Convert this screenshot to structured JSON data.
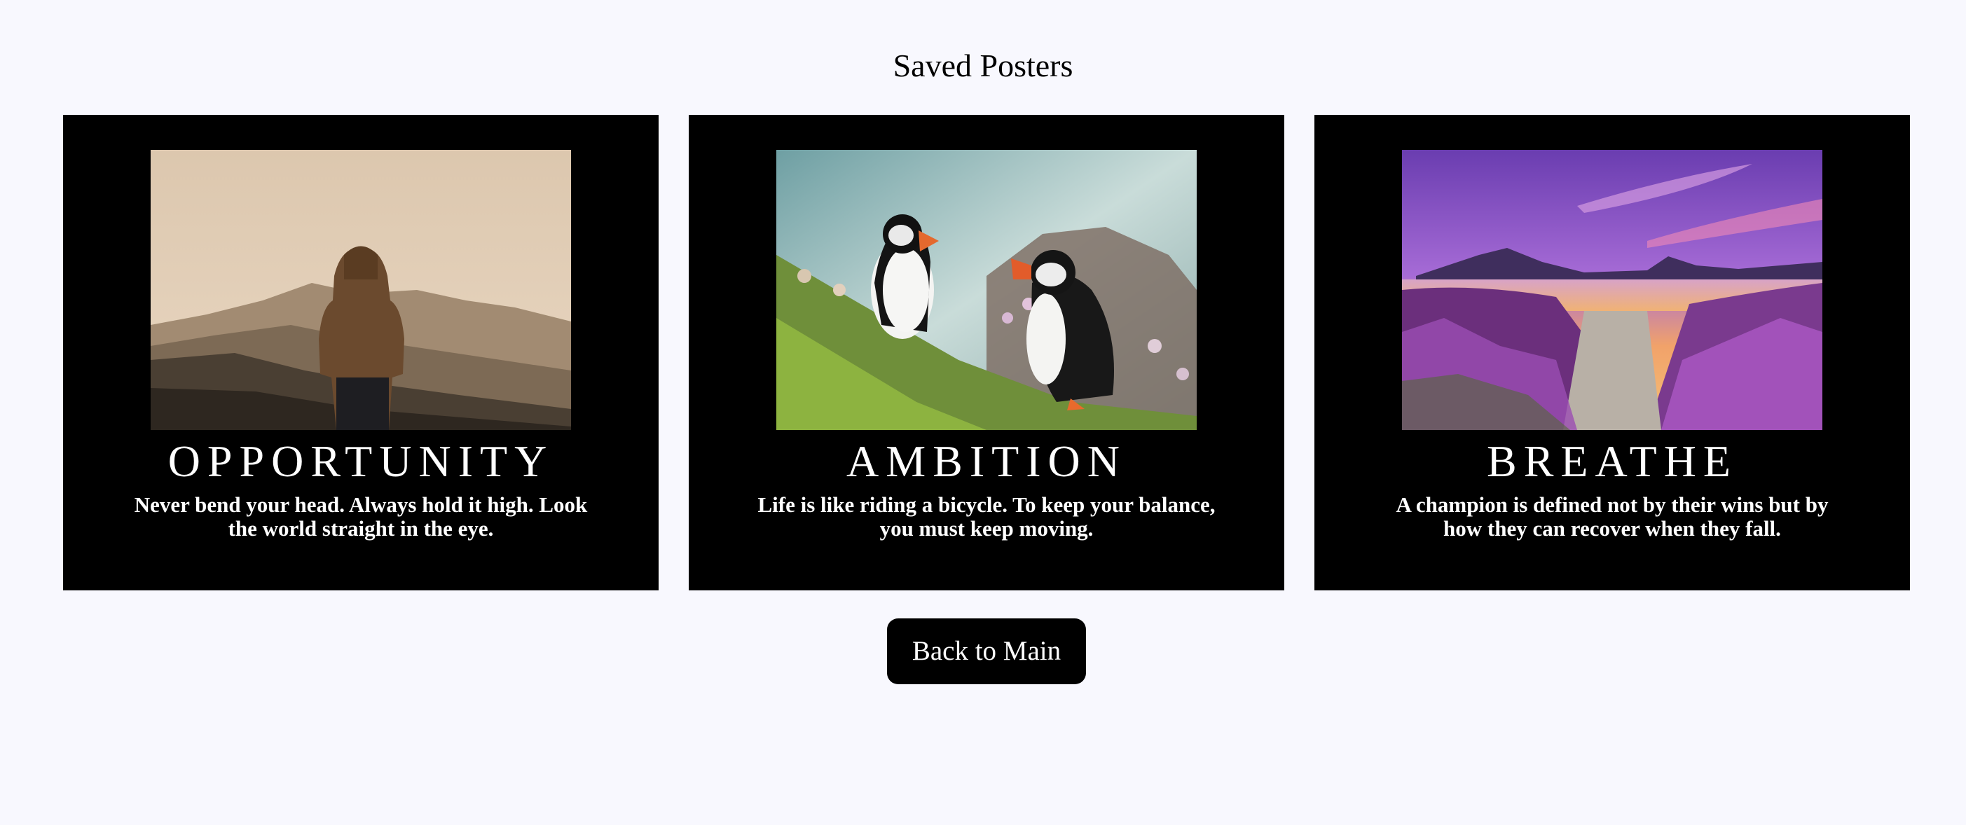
{
  "page": {
    "title": "Saved Posters"
  },
  "posters": [
    {
      "title": "Opportunity",
      "quote": "Never bend your head. Always hold it high. Look the world straight in the eye.",
      "image_icon": "person-on-mountain-photo"
    },
    {
      "title": "Ambition",
      "quote": "Life is like riding a bicycle. To keep your balance, you must keep moving.",
      "image_icon": "puffins-on-cliff-photo"
    },
    {
      "title": "Breathe",
      "quote": "A champion is defined not by their wins but by how they can recover when they fall.",
      "image_icon": "lavender-lake-sunset-photo"
    }
  ],
  "actions": {
    "back_label": "Back to Main"
  },
  "colors": {
    "page_background": "#f8f8fe",
    "poster_background": "#000000",
    "poster_text": "#ffffff",
    "button_background": "#000000"
  }
}
